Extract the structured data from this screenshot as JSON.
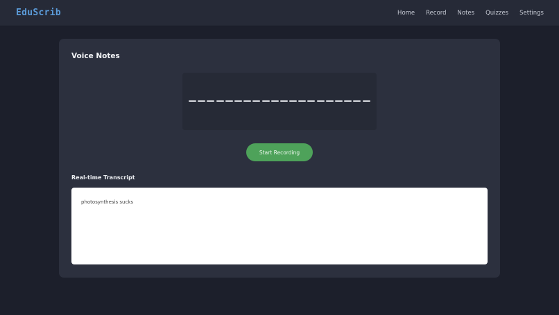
{
  "app": {
    "brand": "EduScrib"
  },
  "nav": {
    "items": [
      {
        "label": "Home"
      },
      {
        "label": "Record"
      },
      {
        "label": "Notes"
      },
      {
        "label": "Quizzes"
      },
      {
        "label": "Settings"
      }
    ]
  },
  "main": {
    "title": "Voice Notes",
    "record_button_label": "Start Recording",
    "transcript_heading": "Real-time Transcript",
    "transcript_text": "photosynthesis sucks"
  },
  "colors": {
    "accent": "#5b9bd9",
    "record_button": "#4ea25a",
    "background": "#1c1f2b",
    "card": "#2c303e"
  }
}
